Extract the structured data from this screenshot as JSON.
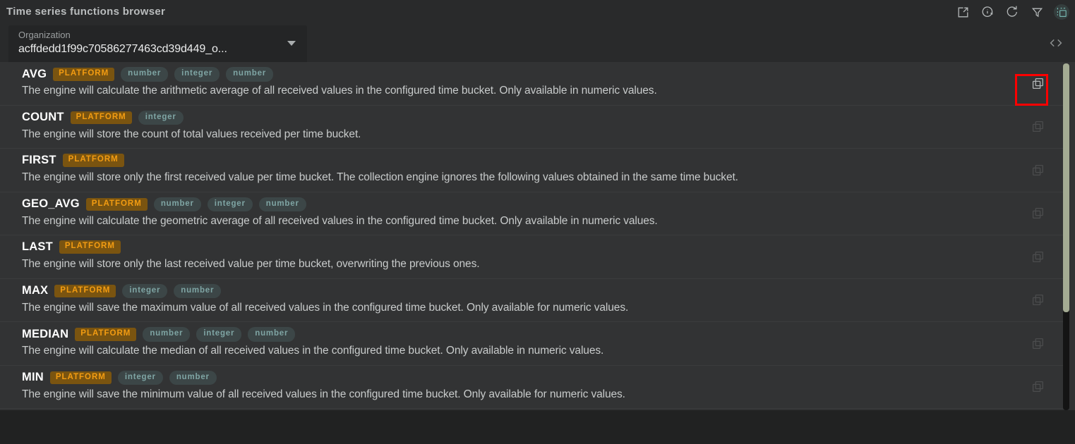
{
  "window": {
    "title": "Time series functions browser"
  },
  "header": {
    "icons": [
      {
        "name": "export-icon",
        "active": false
      },
      {
        "name": "info-icon",
        "active": false
      },
      {
        "name": "refresh-icon",
        "active": false
      },
      {
        "name": "filter-icon",
        "active": false
      },
      {
        "name": "select-area-icon",
        "active": true
      }
    ],
    "active_color": "#74b4ad"
  },
  "organization": {
    "label": "Organization",
    "value": "acffdedd1f99c70586277463cd39d449_o...",
    "caret_icon": "chevron-down-icon",
    "code_icon": "code-brackets-icon"
  },
  "annotation": {
    "color": "#fe0000",
    "target": "copy-button-row-avg"
  },
  "list": {
    "copy_icon": "copy-icon",
    "rows": [
      {
        "name": "AVG",
        "badges": [
          {
            "text": "PLATFORM",
            "kind": "platform"
          },
          {
            "text": "number",
            "kind": "type"
          },
          {
            "text": "integer",
            "kind": "type"
          },
          {
            "text": "number",
            "kind": "type"
          }
        ],
        "description": "The engine will calculate the arithmetic average of all received values in the configured time bucket. Only available in numeric values."
      },
      {
        "name": "COUNT",
        "badges": [
          {
            "text": "PLATFORM",
            "kind": "platform"
          },
          {
            "text": "integer",
            "kind": "type"
          }
        ],
        "description": "The engine will store the count of total values received per time bucket."
      },
      {
        "name": "FIRST",
        "badges": [
          {
            "text": "PLATFORM",
            "kind": "platform"
          }
        ],
        "description": "The engine will store only the first received value per time bucket. The collection engine ignores the following values obtained in the same time bucket."
      },
      {
        "name": "GEO_AVG",
        "badges": [
          {
            "text": "PLATFORM",
            "kind": "platform"
          },
          {
            "text": "number",
            "kind": "type"
          },
          {
            "text": "integer",
            "kind": "type"
          },
          {
            "text": "number",
            "kind": "type"
          }
        ],
        "description": "The engine will calculate the geometric average of all received values in the configured time bucket. Only available in numeric values."
      },
      {
        "name": "LAST",
        "badges": [
          {
            "text": "PLATFORM",
            "kind": "platform"
          }
        ],
        "description": "The engine will store only the last received value per time bucket, overwriting the previous ones."
      },
      {
        "name": "MAX",
        "badges": [
          {
            "text": "PLATFORM",
            "kind": "platform"
          },
          {
            "text": "integer",
            "kind": "type"
          },
          {
            "text": "number",
            "kind": "type"
          }
        ],
        "description": "The engine will save the maximum value of all received values in the configured time bucket. Only available for numeric values."
      },
      {
        "name": "MEDIAN",
        "badges": [
          {
            "text": "PLATFORM",
            "kind": "platform"
          },
          {
            "text": "number",
            "kind": "type"
          },
          {
            "text": "integer",
            "kind": "type"
          },
          {
            "text": "number",
            "kind": "type"
          }
        ],
        "description": "The engine will calculate the median of all received values in the configured time bucket. Only available in numeric values."
      },
      {
        "name": "MIN",
        "badges": [
          {
            "text": "PLATFORM",
            "kind": "platform"
          },
          {
            "text": "integer",
            "kind": "type"
          },
          {
            "text": "number",
            "kind": "type"
          }
        ],
        "description": "The engine will save the minimum value of all received values in the configured time bucket. Only available for numeric values."
      }
    ]
  }
}
